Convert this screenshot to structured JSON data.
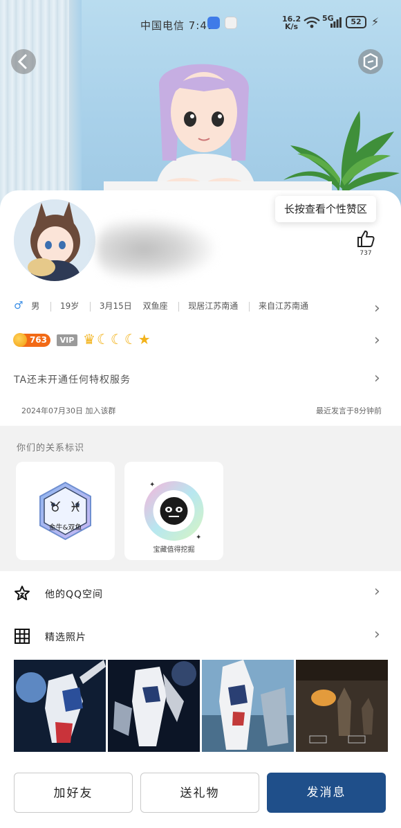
{
  "status_bar": {
    "carrier": "中国电信 7:41",
    "net_speed_value": "16.2",
    "net_speed_unit": "K/s",
    "signal_label": "5G",
    "wifi_label": "6",
    "battery": "52"
  },
  "hero": {
    "back_icon": "chevron-left-icon",
    "shield_icon": "shield-icon"
  },
  "profile": {
    "like_tooltip": "长按查看个性赞区",
    "like_count": "737",
    "info": {
      "gender": "男",
      "age": "19岁",
      "birthday": "3月15日",
      "zodiac": "双鱼座",
      "residence": "现居江苏南通",
      "hometown": "来自江苏南通"
    },
    "level_number": "763",
    "vip_label": "VIP",
    "privilege_text": "TA还未开通任何特权服务",
    "join_date": "2024年07月30日 加入该群",
    "last_speak": "最近发言于8分钟前"
  },
  "relation": {
    "title": "你们的关系标识",
    "cards": [
      {
        "label": "金牛&双鱼"
      },
      {
        "label": "宝藏值得挖掘"
      }
    ]
  },
  "list": {
    "qzone_label": "他的QQ空间",
    "photos_label": "精选照片"
  },
  "actions": {
    "add_friend": "加好友",
    "send_gift": "送礼物",
    "send_message": "发消息"
  },
  "colors": {
    "primary": "#1f4f8a",
    "level_badge": "#f26a16",
    "gender_male": "#3a8ee6"
  }
}
